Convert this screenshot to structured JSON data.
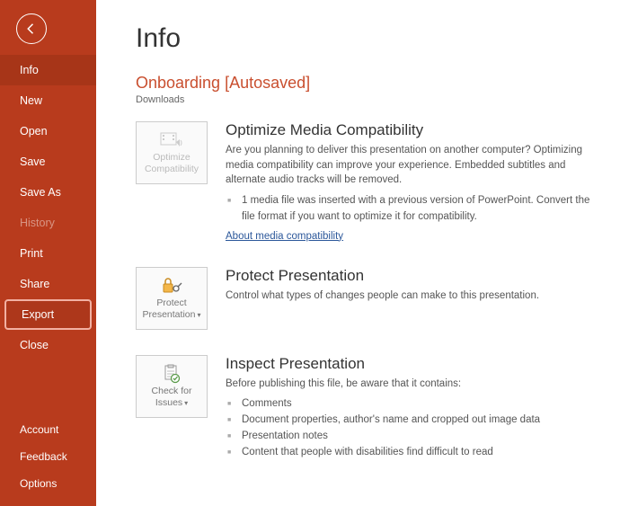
{
  "sidebar": {
    "items": [
      {
        "label": "Info",
        "state": "active"
      },
      {
        "label": "New"
      },
      {
        "label": "Open"
      },
      {
        "label": "Save"
      },
      {
        "label": "Save As"
      },
      {
        "label": "History",
        "state": "disabled"
      },
      {
        "label": "Print"
      },
      {
        "label": "Share"
      },
      {
        "label": "Export",
        "state": "highlighted"
      },
      {
        "label": "Close"
      }
    ],
    "bottom": [
      {
        "label": "Account"
      },
      {
        "label": "Feedback"
      },
      {
        "label": "Options"
      }
    ]
  },
  "page": {
    "title": "Info",
    "doc_title": "Onboarding [Autosaved]",
    "doc_location": "Downloads"
  },
  "sections": {
    "optimize": {
      "tile_l1": "Optimize",
      "tile_l2": "Compatibility",
      "heading": "Optimize Media Compatibility",
      "desc": "Are you planning to deliver this presentation on another computer? Optimizing media compatibility can improve your experience. Embedded subtitles and alternate audio tracks will be removed.",
      "bullet1": "1 media file was inserted with a previous version of PowerPoint. Convert the file format if you want to optimize it for compatibility.",
      "link": "About media compatibility"
    },
    "protect": {
      "tile_l1": "Protect",
      "tile_l2": "Presentation",
      "heading": "Protect Presentation",
      "desc": "Control what types of changes people can make to this presentation."
    },
    "inspect": {
      "tile_l1": "Check for",
      "tile_l2": "Issues",
      "heading": "Inspect Presentation",
      "desc": "Before publishing this file, be aware that it contains:",
      "b1": "Comments",
      "b2": "Document properties, author's name and cropped out image data",
      "b3": "Presentation notes",
      "b4": "Content that people with disabilities find difficult to read"
    }
  }
}
